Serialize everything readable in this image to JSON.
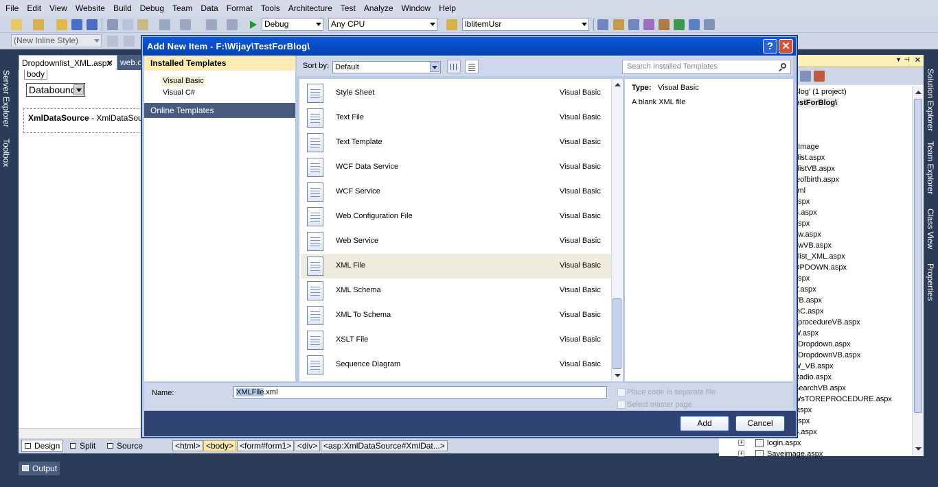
{
  "menu": [
    "File",
    "Edit",
    "View",
    "Website",
    "Build",
    "Debug",
    "Team",
    "Data",
    "Format",
    "Tools",
    "Architecture",
    "Test",
    "Analyze",
    "Window",
    "Help"
  ],
  "toolbar": {
    "config": "Debug",
    "platform": "Any CPU",
    "find": "lblitemUsr",
    "style": "(New Inline Style)"
  },
  "left_dock": {
    "server_explorer": "Server Explorer",
    "toolbox": "Toolbox"
  },
  "right_dock": {
    "solution_explorer": "Solution Explorer",
    "team_explorer": "Team Explorer",
    "class_view": "Class View",
    "properties": "Properties"
  },
  "editor": {
    "tab_active": "Dropdownlist_XML.aspx",
    "tab_inactive": "web.co",
    "body_tag": "body",
    "dropdown_value": "Databound",
    "xml_ds_bold": "XmlDataSource",
    "xml_ds_rest": " - XmlDataSource1"
  },
  "view_bar": {
    "design": "Design",
    "split": "Split",
    "source": "Source",
    "crumbs": [
      "<html>",
      "<body>",
      "<form#form1>",
      "<div>",
      "<asp:XmlDataSource#XmlDat...>"
    ]
  },
  "output": "Output",
  "solution": {
    "items": [
      "Blog' (1 project)",
      "estForBlog\\",
      "e",
      "_Image",
      "klist.aspx",
      "klistVB.aspx",
      "teofbirth.aspx",
      "xml",
      "aspx",
      "B.aspx",
      "aspx",
      "ew.aspx",
      "ewVB.aspx",
      "nlist_XML.aspx",
      "OPDOWN.aspx",
      "aspx",
      "V.aspx",
      "VB.aspx",
      "thC.aspx",
      "eprocedureVB.aspx",
      "W.aspx",
      "_Dropdown.aspx",
      "_DropdownVB.aspx",
      "W_VB.aspx",
      "Radio.aspx",
      "SearchVB.aspx",
      "WsTOREPROCEDURE.aspx",
      ".aspx",
      "aspx",
      "B.aspx",
      "login.aspx",
      "Saveimage.aspx"
    ]
  },
  "dialog": {
    "title": "Add New Item - F:\\Wijay\\TestForBlog\\",
    "help": "?",
    "close": "✕",
    "installed": "Installed Templates",
    "languages": [
      "Visual Basic",
      "Visual C#"
    ],
    "online": "Online Templates",
    "sort_label": "Sort by:",
    "sort_value": "Default",
    "search_placeholder": "Search Installed Templates",
    "templates": [
      {
        "name": "Style Sheet",
        "lang": "Visual Basic"
      },
      {
        "name": "Text File",
        "lang": "Visual Basic"
      },
      {
        "name": "Text Template",
        "lang": "Visual Basic"
      },
      {
        "name": "WCF Data Service",
        "lang": "Visual Basic"
      },
      {
        "name": "WCF Service",
        "lang": "Visual Basic"
      },
      {
        "name": "Web Configuration File",
        "lang": "Visual Basic"
      },
      {
        "name": "Web Service",
        "lang": "Visual Basic"
      },
      {
        "name": "XML File",
        "lang": "Visual Basic"
      },
      {
        "name": "XML Schema",
        "lang": "Visual Basic"
      },
      {
        "name": "XML To Schema",
        "lang": "Visual Basic"
      },
      {
        "name": "XSLT File",
        "lang": "Visual Basic"
      },
      {
        "name": "Sequence Diagram",
        "lang": "Visual Basic"
      }
    ],
    "selected_index": 7,
    "type_label": "Type:",
    "type_value": "Visual Basic",
    "description": "A blank XML file",
    "name_label": "Name:",
    "name_highlight": "XMLFile",
    "name_rest": ".xml",
    "option_code": "Place code in separate file",
    "option_master": "Select master page",
    "add": "Add",
    "cancel": "Cancel"
  }
}
